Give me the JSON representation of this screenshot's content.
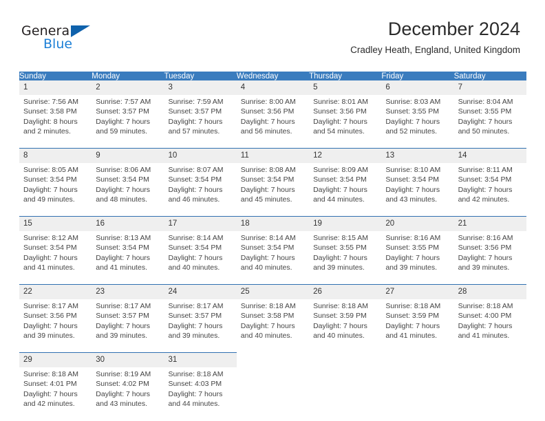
{
  "brand": {
    "name_part1": "General",
    "name_part2": "Blue",
    "triangle_color": "#0f62ac",
    "blue_color": "#1c7fd6"
  },
  "header": {
    "title": "December 2024",
    "subtitle": "Cradley Heath, England, United Kingdom",
    "header_bg": "#3a7cbe",
    "row_divider_color": "#2f6fb0",
    "daynum_bg": "#efefef"
  },
  "weekday_headers": [
    "Sunday",
    "Monday",
    "Tuesday",
    "Wednesday",
    "Thursday",
    "Friday",
    "Saturday"
  ],
  "weeks": [
    [
      {
        "day": "1",
        "sunrise": "Sunrise: 7:56 AM",
        "sunset": "Sunset: 3:58 PM",
        "daylight_line1": "Daylight: 8 hours",
        "daylight_line2": "and 2 minutes."
      },
      {
        "day": "2",
        "sunrise": "Sunrise: 7:57 AM",
        "sunset": "Sunset: 3:57 PM",
        "daylight_line1": "Daylight: 7 hours",
        "daylight_line2": "and 59 minutes."
      },
      {
        "day": "3",
        "sunrise": "Sunrise: 7:59 AM",
        "sunset": "Sunset: 3:57 PM",
        "daylight_line1": "Daylight: 7 hours",
        "daylight_line2": "and 57 minutes."
      },
      {
        "day": "4",
        "sunrise": "Sunrise: 8:00 AM",
        "sunset": "Sunset: 3:56 PM",
        "daylight_line1": "Daylight: 7 hours",
        "daylight_line2": "and 56 minutes."
      },
      {
        "day": "5",
        "sunrise": "Sunrise: 8:01 AM",
        "sunset": "Sunset: 3:56 PM",
        "daylight_line1": "Daylight: 7 hours",
        "daylight_line2": "and 54 minutes."
      },
      {
        "day": "6",
        "sunrise": "Sunrise: 8:03 AM",
        "sunset": "Sunset: 3:55 PM",
        "daylight_line1": "Daylight: 7 hours",
        "daylight_line2": "and 52 minutes."
      },
      {
        "day": "7",
        "sunrise": "Sunrise: 8:04 AM",
        "sunset": "Sunset: 3:55 PM",
        "daylight_line1": "Daylight: 7 hours",
        "daylight_line2": "and 50 minutes."
      }
    ],
    [
      {
        "day": "8",
        "sunrise": "Sunrise: 8:05 AM",
        "sunset": "Sunset: 3:54 PM",
        "daylight_line1": "Daylight: 7 hours",
        "daylight_line2": "and 49 minutes."
      },
      {
        "day": "9",
        "sunrise": "Sunrise: 8:06 AM",
        "sunset": "Sunset: 3:54 PM",
        "daylight_line1": "Daylight: 7 hours",
        "daylight_line2": "and 48 minutes."
      },
      {
        "day": "10",
        "sunrise": "Sunrise: 8:07 AM",
        "sunset": "Sunset: 3:54 PM",
        "daylight_line1": "Daylight: 7 hours",
        "daylight_line2": "and 46 minutes."
      },
      {
        "day": "11",
        "sunrise": "Sunrise: 8:08 AM",
        "sunset": "Sunset: 3:54 PM",
        "daylight_line1": "Daylight: 7 hours",
        "daylight_line2": "and 45 minutes."
      },
      {
        "day": "12",
        "sunrise": "Sunrise: 8:09 AM",
        "sunset": "Sunset: 3:54 PM",
        "daylight_line1": "Daylight: 7 hours",
        "daylight_line2": "and 44 minutes."
      },
      {
        "day": "13",
        "sunrise": "Sunrise: 8:10 AM",
        "sunset": "Sunset: 3:54 PM",
        "daylight_line1": "Daylight: 7 hours",
        "daylight_line2": "and 43 minutes."
      },
      {
        "day": "14",
        "sunrise": "Sunrise: 8:11 AM",
        "sunset": "Sunset: 3:54 PM",
        "daylight_line1": "Daylight: 7 hours",
        "daylight_line2": "and 42 minutes."
      }
    ],
    [
      {
        "day": "15",
        "sunrise": "Sunrise: 8:12 AM",
        "sunset": "Sunset: 3:54 PM",
        "daylight_line1": "Daylight: 7 hours",
        "daylight_line2": "and 41 minutes."
      },
      {
        "day": "16",
        "sunrise": "Sunrise: 8:13 AM",
        "sunset": "Sunset: 3:54 PM",
        "daylight_line1": "Daylight: 7 hours",
        "daylight_line2": "and 41 minutes."
      },
      {
        "day": "17",
        "sunrise": "Sunrise: 8:14 AM",
        "sunset": "Sunset: 3:54 PM",
        "daylight_line1": "Daylight: 7 hours",
        "daylight_line2": "and 40 minutes."
      },
      {
        "day": "18",
        "sunrise": "Sunrise: 8:14 AM",
        "sunset": "Sunset: 3:54 PM",
        "daylight_line1": "Daylight: 7 hours",
        "daylight_line2": "and 40 minutes."
      },
      {
        "day": "19",
        "sunrise": "Sunrise: 8:15 AM",
        "sunset": "Sunset: 3:55 PM",
        "daylight_line1": "Daylight: 7 hours",
        "daylight_line2": "and 39 minutes."
      },
      {
        "day": "20",
        "sunrise": "Sunrise: 8:16 AM",
        "sunset": "Sunset: 3:55 PM",
        "daylight_line1": "Daylight: 7 hours",
        "daylight_line2": "and 39 minutes."
      },
      {
        "day": "21",
        "sunrise": "Sunrise: 8:16 AM",
        "sunset": "Sunset: 3:56 PM",
        "daylight_line1": "Daylight: 7 hours",
        "daylight_line2": "and 39 minutes."
      }
    ],
    [
      {
        "day": "22",
        "sunrise": "Sunrise: 8:17 AM",
        "sunset": "Sunset: 3:56 PM",
        "daylight_line1": "Daylight: 7 hours",
        "daylight_line2": "and 39 minutes."
      },
      {
        "day": "23",
        "sunrise": "Sunrise: 8:17 AM",
        "sunset": "Sunset: 3:57 PM",
        "daylight_line1": "Daylight: 7 hours",
        "daylight_line2": "and 39 minutes."
      },
      {
        "day": "24",
        "sunrise": "Sunrise: 8:17 AM",
        "sunset": "Sunset: 3:57 PM",
        "daylight_line1": "Daylight: 7 hours",
        "daylight_line2": "and 39 minutes."
      },
      {
        "day": "25",
        "sunrise": "Sunrise: 8:18 AM",
        "sunset": "Sunset: 3:58 PM",
        "daylight_line1": "Daylight: 7 hours",
        "daylight_line2": "and 40 minutes."
      },
      {
        "day": "26",
        "sunrise": "Sunrise: 8:18 AM",
        "sunset": "Sunset: 3:59 PM",
        "daylight_line1": "Daylight: 7 hours",
        "daylight_line2": "and 40 minutes."
      },
      {
        "day": "27",
        "sunrise": "Sunrise: 8:18 AM",
        "sunset": "Sunset: 3:59 PM",
        "daylight_line1": "Daylight: 7 hours",
        "daylight_line2": "and 41 minutes."
      },
      {
        "day": "28",
        "sunrise": "Sunrise: 8:18 AM",
        "sunset": "Sunset: 4:00 PM",
        "daylight_line1": "Daylight: 7 hours",
        "daylight_line2": "and 41 minutes."
      }
    ],
    [
      {
        "day": "29",
        "sunrise": "Sunrise: 8:18 AM",
        "sunset": "Sunset: 4:01 PM",
        "daylight_line1": "Daylight: 7 hours",
        "daylight_line2": "and 42 minutes."
      },
      {
        "day": "30",
        "sunrise": "Sunrise: 8:19 AM",
        "sunset": "Sunset: 4:02 PM",
        "daylight_line1": "Daylight: 7 hours",
        "daylight_line2": "and 43 minutes."
      },
      {
        "day": "31",
        "sunrise": "Sunrise: 8:18 AM",
        "sunset": "Sunset: 4:03 PM",
        "daylight_line1": "Daylight: 7 hours",
        "daylight_line2": "and 44 minutes."
      },
      {
        "day": "",
        "sunrise": "",
        "sunset": "",
        "daylight_line1": "",
        "daylight_line2": ""
      },
      {
        "day": "",
        "sunrise": "",
        "sunset": "",
        "daylight_line1": "",
        "daylight_line2": ""
      },
      {
        "day": "",
        "sunrise": "",
        "sunset": "",
        "daylight_line1": "",
        "daylight_line2": ""
      },
      {
        "day": "",
        "sunrise": "",
        "sunset": "",
        "daylight_line1": "",
        "daylight_line2": ""
      }
    ]
  ]
}
